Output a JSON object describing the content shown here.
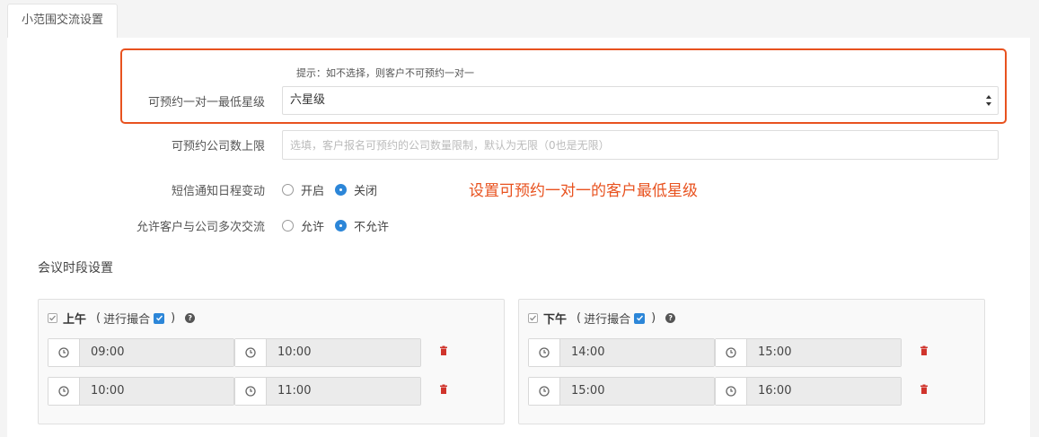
{
  "tab": {
    "label": "小范围交流设置"
  },
  "form": {
    "hint": "提示：如不选择，则客户不可预约一对一",
    "min_star": {
      "label": "可预约一对一最低星级",
      "value": "六星级"
    },
    "company_limit": {
      "label": "可预约公司数上限",
      "value": "",
      "placeholder": "选填，客户报名可预约的公司数量限制，默认为无限（0也是无限）"
    },
    "sms_notify": {
      "label": "短信通知日程变动",
      "options": [
        "开启",
        "关闭"
      ],
      "selected": "关闭"
    },
    "multi_exchange": {
      "label": "允许客户与公司多次交流",
      "options": [
        "允许",
        "不允许"
      ],
      "selected": "不允许"
    }
  },
  "annotation": {
    "text": "设置可预约一对一的客户最低星级",
    "color": "#e8521f"
  },
  "meeting": {
    "title": "会议时段设置",
    "panels": [
      {
        "title": "上午",
        "merge_label": "进行撮合",
        "checked": true,
        "merge_checked": true,
        "slots": [
          {
            "start": "09:00",
            "end": "10:00"
          },
          {
            "start": "10:00",
            "end": "11:00"
          }
        ]
      },
      {
        "title": "下午",
        "merge_label": "进行撮合",
        "checked": true,
        "merge_checked": true,
        "slots": [
          {
            "start": "14:00",
            "end": "15:00"
          },
          {
            "start": "15:00",
            "end": "16:00"
          }
        ]
      }
    ]
  },
  "colors": {
    "accent": "#2c86d8",
    "danger": "#d0342c",
    "highlight": "#e8521f"
  }
}
